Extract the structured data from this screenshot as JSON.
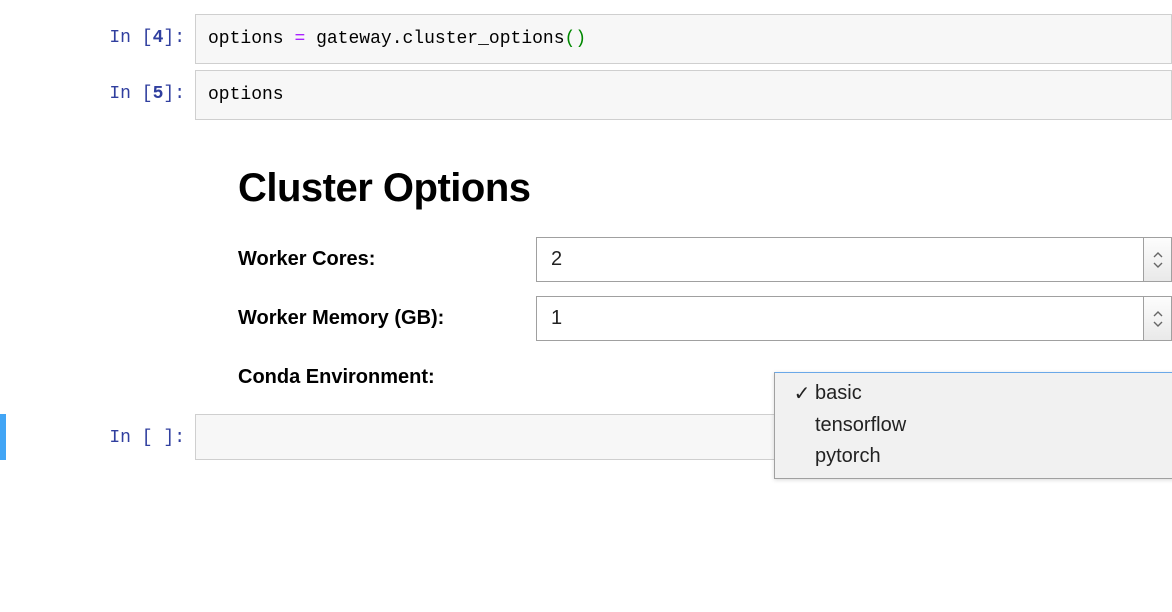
{
  "cells": {
    "c0": {
      "prompt_prefix": "In [",
      "num": "4",
      "prompt_suffix": "]:"
    },
    "c1": {
      "prompt_prefix": "In [",
      "num": "5",
      "prompt_suffix": "]:"
    },
    "c2": {
      "prompt_prefix": "In [",
      "num": " ",
      "prompt_suffix": "]:"
    }
  },
  "code": {
    "c0": {
      "t0": "options",
      "t1": " ",
      "t2": "=",
      "t3": " ",
      "t4": "gateway",
      "t5": ".",
      "t6": "cluster_options",
      "t7": "(",
      "t8": ")"
    },
    "c1": {
      "t0": "options"
    },
    "c2": {
      "t0": ""
    }
  },
  "output": {
    "title": "Cluster Options",
    "fields": {
      "cores": {
        "label": "Worker Cores:",
        "value": "2"
      },
      "memory": {
        "label": "Worker Memory (GB):",
        "value": "1"
      },
      "env": {
        "label": "Conda Environment:"
      }
    },
    "env_options": {
      "o0": {
        "check": "✓",
        "label": "basic"
      },
      "o1": {
        "check": "",
        "label": "tensorflow"
      },
      "o2": {
        "check": "",
        "label": "pytorch"
      }
    }
  }
}
